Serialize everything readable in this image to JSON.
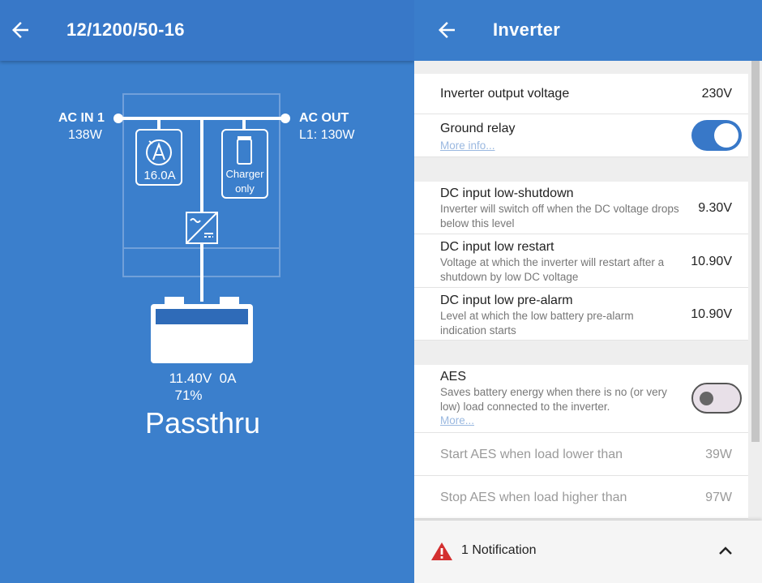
{
  "left_panel": {
    "title": "12/1200/50-16",
    "ac_in": {
      "label": "AC IN 1",
      "power": "138W"
    },
    "ac_out": {
      "label": "AC OUT",
      "power": "L1: 130W"
    },
    "current_limit": "16.0A",
    "charger_mode": {
      "line1": "Charger",
      "line2": "only"
    },
    "battery": {
      "voltage": "11.40V",
      "current": "0A",
      "soc": "71%"
    },
    "state": "Passthru"
  },
  "right_panel": {
    "title": "Inverter",
    "settings": {
      "output_voltage": {
        "label": "Inverter output voltage",
        "value": "230V"
      },
      "ground_relay": {
        "label": "Ground relay",
        "link": "More info...",
        "enabled": true
      },
      "low_shutdown": {
        "label": "DC input low-shutdown",
        "description": "Inverter will switch off when the DC voltage drops below this level",
        "value": "9.30V"
      },
      "low_restart": {
        "label": "DC input low restart",
        "description": "Voltage at which the inverter will restart after a shutdown by low DC voltage",
        "value": "10.90V"
      },
      "low_prealarm": {
        "label": "DC input low pre-alarm",
        "description": "Level at which the low battery pre-alarm indication starts",
        "value": "10.90V"
      },
      "aes": {
        "label": "AES",
        "description": "Saves battery energy when there is no (or very low) load connected to the inverter.",
        "link": "More...",
        "enabled": false
      },
      "aes_start": {
        "label": "Start AES when load lower than",
        "value": "39W"
      },
      "aes_stop": {
        "label": "Stop AES when load higher than",
        "value": "97W"
      }
    },
    "notification": {
      "text": "1 Notification"
    }
  },
  "colors": {
    "primary": "#3878c8",
    "toggle_on": "#3878c8",
    "warning": "#d32f2f"
  },
  "icons": {
    "back": "arrow-left-icon",
    "current": "ampere-gauge-icon",
    "charger": "battery-charger-icon",
    "inverter": "ac-dc-converter-icon",
    "warning": "warning-triangle-icon",
    "expand": "chevron-up-icon"
  }
}
